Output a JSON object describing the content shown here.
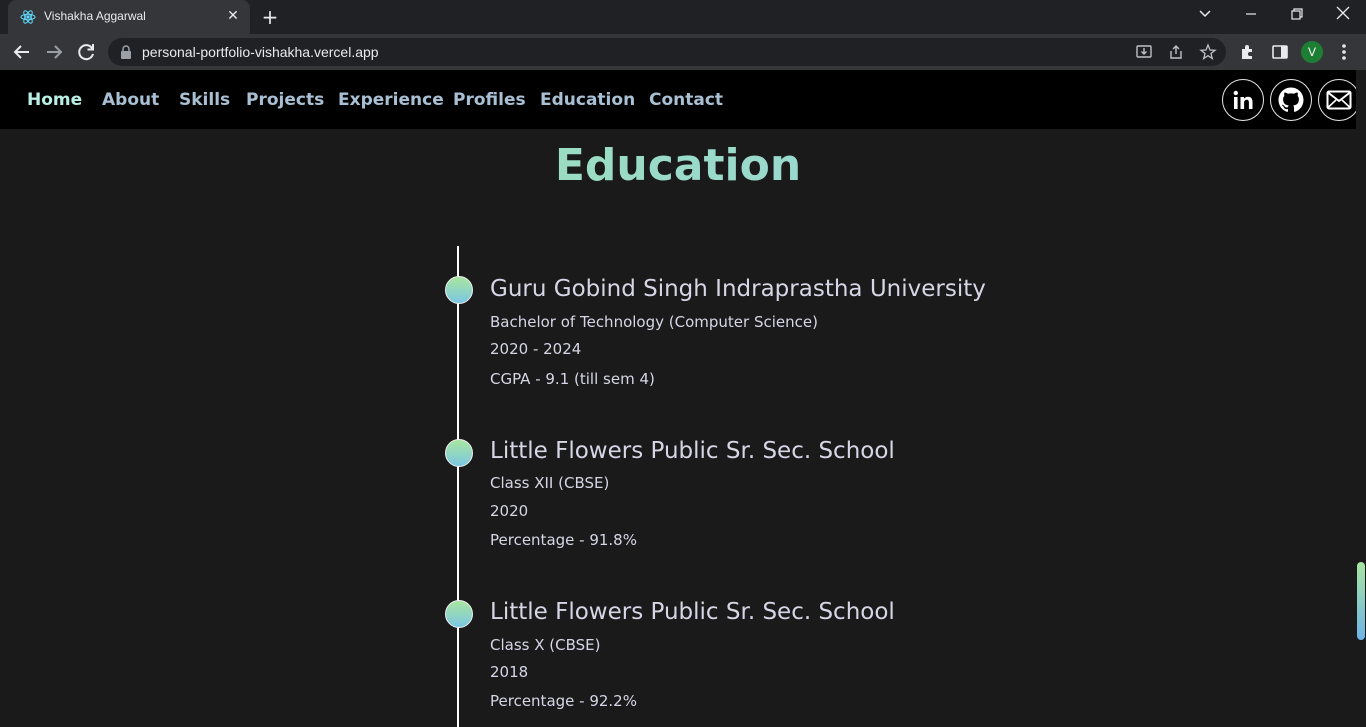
{
  "browser": {
    "tab_title": "Vishakha Aggarwal",
    "tab_close": "✕",
    "new_tab": "+",
    "url": "personal-portfolio-vishakha.vercel.app",
    "profile_initial": "V"
  },
  "nav": {
    "links": [
      "Home",
      "About",
      "Skills",
      "Projects",
      "Experience",
      "Profiles",
      "Education",
      "Contact"
    ],
    "active": "Home",
    "social": [
      "linkedin-icon",
      "github-icon",
      "mail-icon"
    ]
  },
  "section": {
    "title": "Education"
  },
  "education": [
    {
      "name": "Guru Gobind Singh Indraprastha University",
      "degree": "Bachelor of Technology (Computer Science)",
      "years": "2020 - 2024",
      "score": "CGPA - 9.1 (till sem 4)"
    },
    {
      "name": "Little Flowers Public Sr. Sec. School",
      "degree": "Class XII (CBSE)",
      "years": "2020",
      "score": "Percentage - 91.8%"
    },
    {
      "name": "Little Flowers Public Sr. Sec. School",
      "degree": "Class X (CBSE)",
      "years": "2018",
      "score": "Percentage - 92.2%"
    }
  ],
  "colors": {
    "accent_green": "#9be5a8",
    "accent_blue": "#7cc6e4",
    "nav_text": "#a9c0d4",
    "background": "#1a1a1a"
  }
}
